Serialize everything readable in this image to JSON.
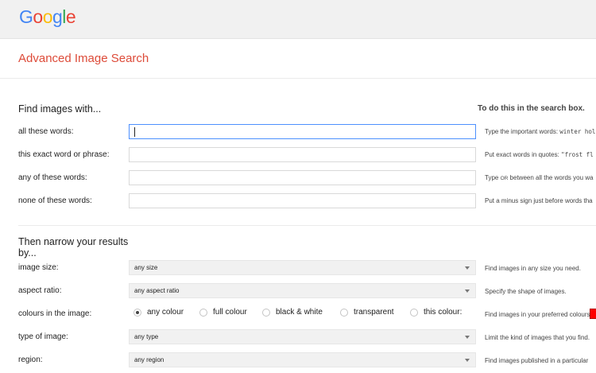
{
  "brand": {
    "letters": [
      {
        "ch": "G",
        "color": "#4285f4"
      },
      {
        "ch": "o",
        "color": "#ea4335"
      },
      {
        "ch": "o",
        "color": "#fbbc05"
      },
      {
        "ch": "g",
        "color": "#4285f4"
      },
      {
        "ch": "l",
        "color": "#34a853"
      },
      {
        "ch": "e",
        "color": "#ea4335"
      }
    ]
  },
  "page": {
    "title": "Advanced Image Search",
    "accent_color": "#dd4b39"
  },
  "find": {
    "heading": "Find images with...",
    "side_heading": "To do this in the search box.",
    "rows": [
      {
        "label": "all these words:",
        "value": "",
        "hint_pre": "Type the important words: ",
        "hint_code": "winter hol",
        "hint_post": ""
      },
      {
        "label": "this exact word or phrase:",
        "value": "",
        "hint_pre": "Put exact words in quotes: ",
        "hint_code": "\"frost fl",
        "hint_post": ""
      },
      {
        "label": "any of these words:",
        "value": "",
        "hint_pre": "Type ",
        "hint_code": "OR",
        "hint_post": " between all the words you wa"
      },
      {
        "label": "none of these words:",
        "value": "",
        "hint_pre": "Put a minus sign just before words tha",
        "hint_code": "",
        "hint_post": ""
      }
    ]
  },
  "narrow": {
    "heading_line1": "Then narrow your results",
    "heading_line2": "by...",
    "image_size": {
      "label": "image size:",
      "selected": "any size",
      "hint": "Find images in any size you need."
    },
    "aspect_ratio": {
      "label": "aspect ratio:",
      "selected": "any aspect ratio",
      "hint": "Specify the shape of images."
    },
    "colours": {
      "label": "colours in the image:",
      "options": [
        "any colour",
        "full colour",
        "black & white",
        "transparent",
        "this colour:"
      ],
      "selected_index": 0,
      "swatch_color": "#ff0000",
      "hint": "Find images in your preferred colours"
    },
    "type_of_image": {
      "label": "type of image:",
      "selected": "any type",
      "hint": "Limit the kind of images that you find."
    },
    "region": {
      "label": "region:",
      "selected": "any region",
      "hint": "Find images published in a particular "
    }
  }
}
